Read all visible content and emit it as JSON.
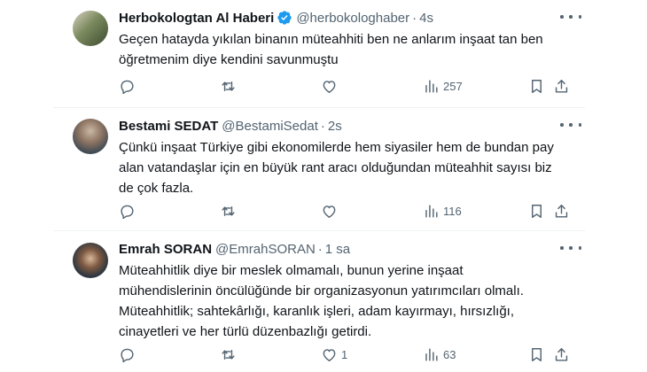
{
  "tweets": [
    {
      "display_name": "Herbokologtan Al Haberi",
      "verified": true,
      "handle": "@herbokologhaber",
      "separator": "·",
      "time": "4s",
      "text": "Geçen hatayda yıkılan binanın müteahhiti ben ne anlarım inşaat tan ben\nöğretmenim diye kendini savunmuştu",
      "reply_count": "",
      "retweet_count": "",
      "like_count": "",
      "view_count": "257"
    },
    {
      "display_name": "Bestami SEDAT",
      "verified": false,
      "handle": "@BestamiSedat",
      "separator": "·",
      "time": "2s",
      "text": "Çünkü inşaat Türkiye gibi ekonomilerde hem siyasiler hem de bundan pay\nalan vatandaşlar için en büyük rant aracı olduğundan müteahhit sayısı biz\nde çok fazla.",
      "reply_count": "",
      "retweet_count": "",
      "like_count": "",
      "view_count": "116"
    },
    {
      "display_name": "Emrah SORAN",
      "verified": false,
      "handle": "@EmrahSORAN",
      "separator": "·",
      "time": "1 sa",
      "text": "Müteahhitlik diye bir meslek olmamalı, bunun yerine inşaat\nmühendislerinin öncülüğünde bir organizasyonun yatırımcıları olmalı.\nMüteahhitlik; sahtekârlığı, karanlık işleri, adam kayırmayı, hırsızlığı,\ncinayetleri ve her türlü düzenbazlığı getirdi.",
      "reply_count": "",
      "retweet_count": "",
      "like_count": "1",
      "view_count": "63"
    }
  ],
  "colors": {
    "text": "#0f1419",
    "secondary": "#536471",
    "verified": "#1d9bf0",
    "divider": "#eff3f4"
  },
  "icons": [
    "reply-icon",
    "retweet-icon",
    "like-icon",
    "views-icon",
    "bookmark-icon",
    "share-icon",
    "more-icon",
    "verified-icon"
  ]
}
